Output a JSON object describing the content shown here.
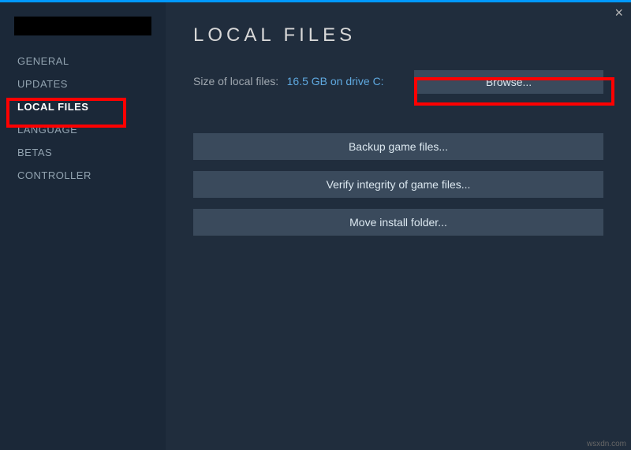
{
  "window": {
    "close_glyph": "×"
  },
  "sidebar": {
    "items": [
      {
        "label": "GENERAL"
      },
      {
        "label": "UPDATES"
      },
      {
        "label": "LOCAL FILES"
      },
      {
        "label": "LANGUAGE"
      },
      {
        "label": "BETAS"
      },
      {
        "label": "CONTROLLER"
      }
    ]
  },
  "main": {
    "title": "LOCAL FILES",
    "size_label": "Size of local files:",
    "size_value": "16.5 GB on drive C:",
    "browse_label": "Browse...",
    "buttons": [
      {
        "label": "Backup game files..."
      },
      {
        "label": "Verify integrity of game files..."
      },
      {
        "label": "Move install folder..."
      }
    ]
  },
  "watermark": "wsxdn.com"
}
